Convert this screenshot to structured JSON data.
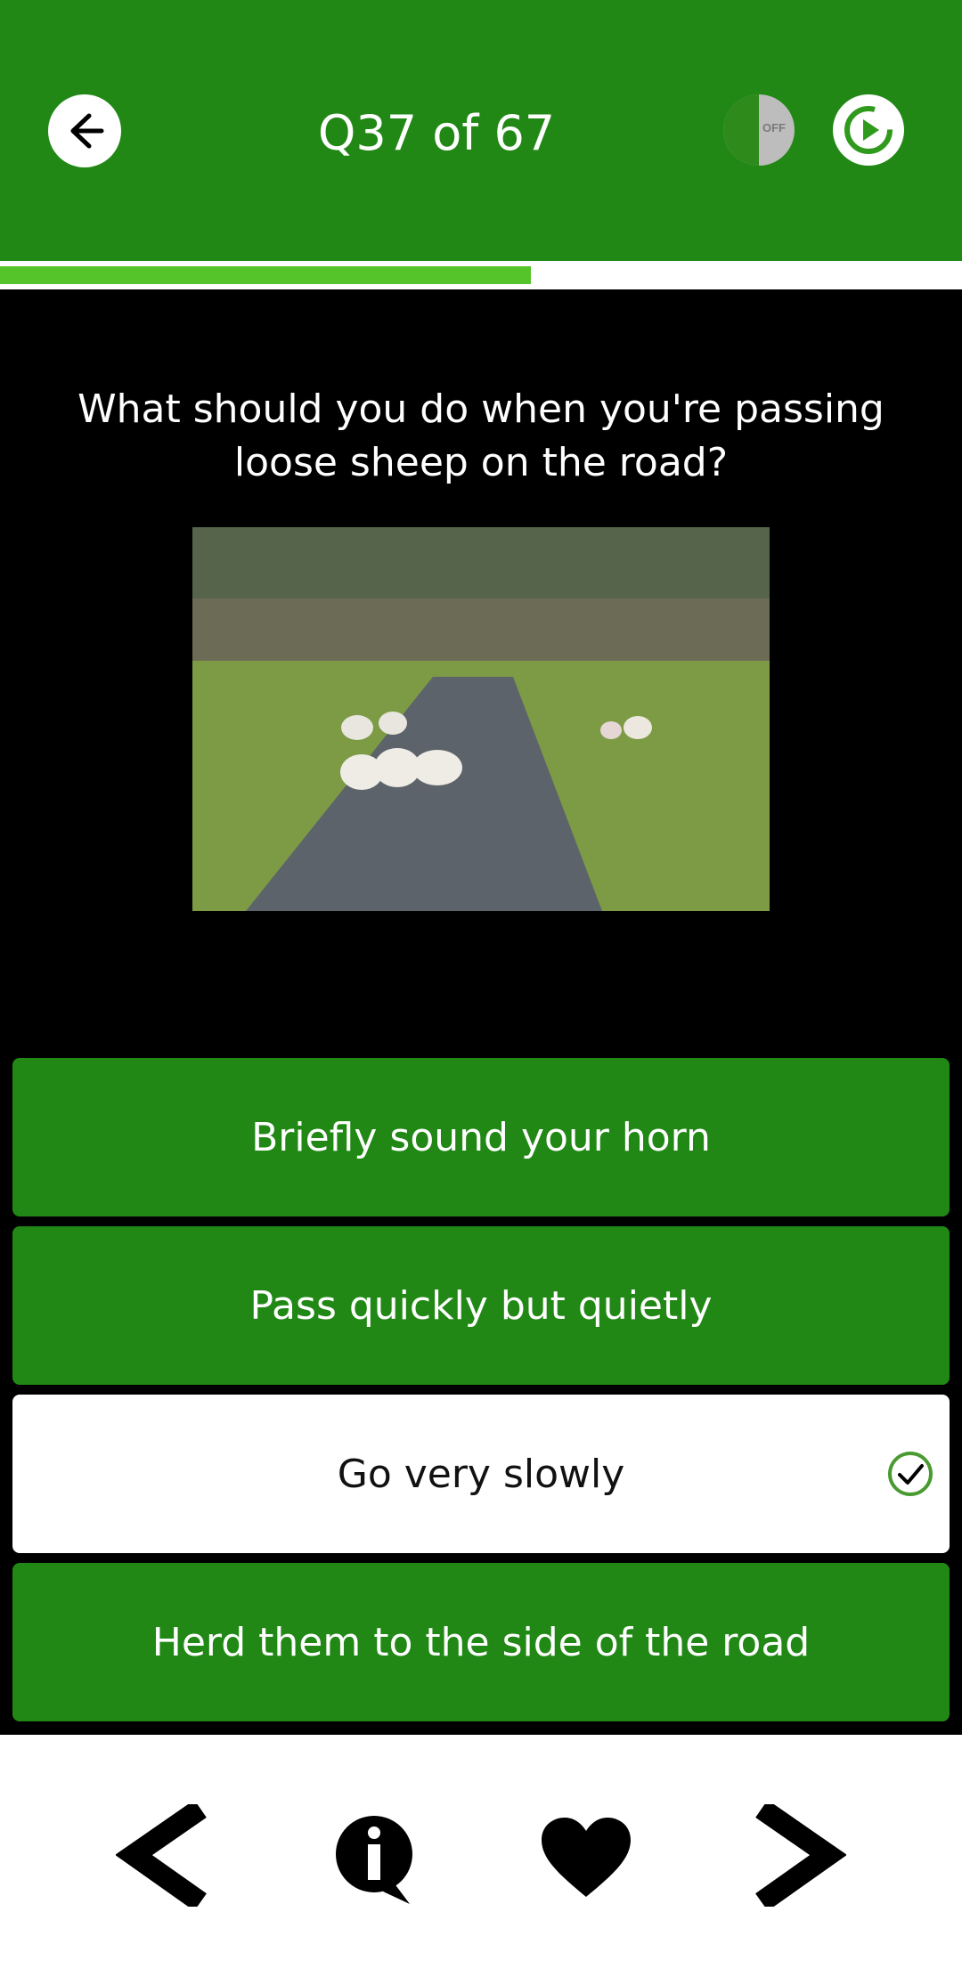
{
  "header": {
    "title": "Q37 of 67",
    "voice_toggle": {
      "icon": "voice-off-icon",
      "state_label": "OFF"
    },
    "back_icon": "arrow-left-icon",
    "replay_icon": "replay-icon"
  },
  "progress": {
    "current": 37,
    "total": 67,
    "fraction": 0.552
  },
  "question": {
    "text": "What should you do when you're passing loose sheep on the road?",
    "image": "photo of sheep on a rural road"
  },
  "answers": [
    {
      "label": "Briefly sound your horn",
      "state": "default"
    },
    {
      "label": "Pass quickly but quietly",
      "state": "default"
    },
    {
      "label": "Go very slowly",
      "state": "correct",
      "icon": "check-circle-icon"
    },
    {
      "label": "Herd them to the side of the road",
      "state": "default"
    }
  ],
  "bottom_nav": {
    "icons": [
      "chevron-left-icon",
      "info-icon",
      "heart-icon",
      "chevron-right-icon"
    ]
  },
  "colors": {
    "primary_green": "#218815",
    "progress_green": "#55c42a",
    "background": "#000000",
    "text_light": "#ffffff"
  }
}
